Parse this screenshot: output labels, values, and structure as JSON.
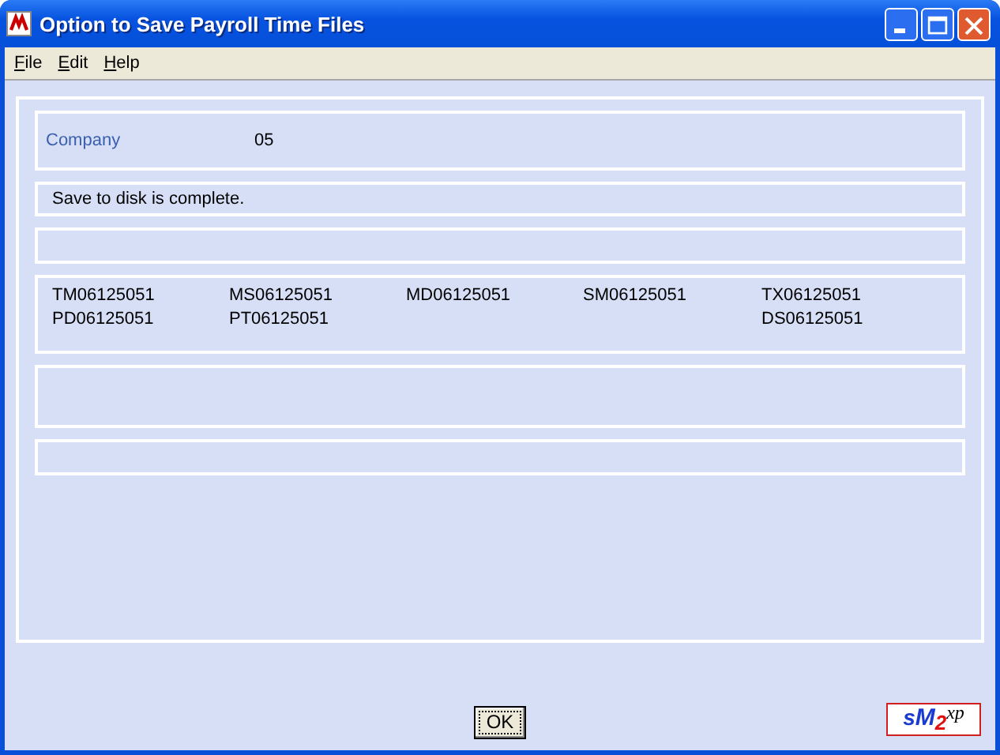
{
  "window": {
    "title": "Option to Save Payroll Time Files"
  },
  "menu": [
    {
      "label": "File"
    },
    {
      "label": "Edit"
    },
    {
      "label": "Help"
    }
  ],
  "company": {
    "label": "Company",
    "value": "05"
  },
  "message": "Save to disk is complete.",
  "files": {
    "column_1": [
      "TM06125051",
      "PD06125051"
    ],
    "column_2": [
      "MS06125051",
      "PT06125051"
    ],
    "column_3": [
      "MD06125051"
    ],
    "column_4": [
      "SM06125051"
    ],
    "column_5": [
      "TX06125051",
      "DS06125051"
    ]
  },
  "buttons": [
    "OK"
  ],
  "logo": {
    "parts": [
      "s",
      "M",
      "2",
      "xp"
    ]
  }
}
